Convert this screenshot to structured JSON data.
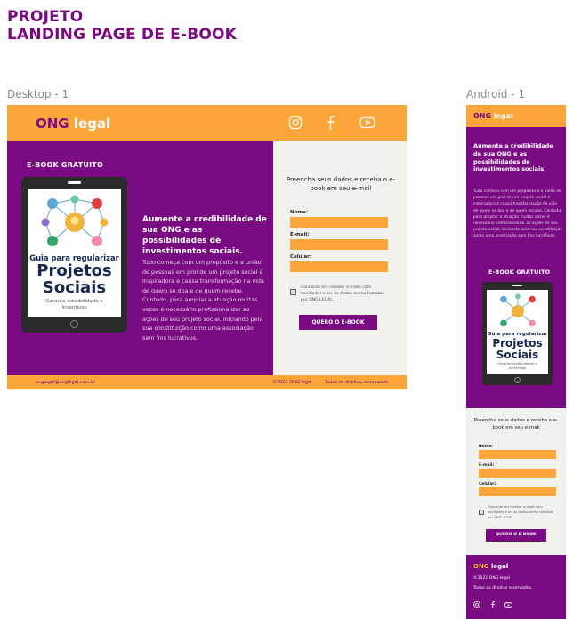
{
  "page": {
    "title_line1": "PROJETO",
    "title_line2": "LANDING PAGE DE E-BOOK"
  },
  "frames": {
    "desktop_label": "Desktop - 1",
    "android_label": "Android - 1"
  },
  "brand": {
    "logo_ong": "ONG",
    "logo_legal": "legal",
    "colors": {
      "purple": "#7a0a82",
      "orange": "#fba63a",
      "form_bg": "#f2f2ec"
    }
  },
  "social_icons": [
    "instagram-icon",
    "facebook-icon",
    "youtube-icon"
  ],
  "hero": {
    "ebook_label": "E-BOOK GRATUITO",
    "heading": "Aumente a credibilidade de sua ONG e as possibilidades de investimentos sociais.",
    "body": "Tudo começa com um propósito e a união de pessoas em prol de um projeto social é inspiradora e causa transformação na vida de quem se doa e de quem recebe. Contudo, para ampliar a atuação muitas vezes é necessário profissionalizar as ações de seu projeto social, iniciando pela sua constituição como uma associação sem fins lucrativos."
  },
  "cover": {
    "line1": "Guia para regularizar",
    "line2": "Projetos",
    "line3": "Sociais",
    "subtitle": "Garanta credibilidade e incentivos"
  },
  "form": {
    "title": "Preencha seus dados e receba o e-book em seu e-mail",
    "name_label": "Nome:",
    "email_label": "E-mail:",
    "phone_label": "Celular:",
    "consent": "Concordo em receber e-mails com novidades e ter os dados acima tratados por ONG LEGAL",
    "submit": "QUERO O E-BOOK"
  },
  "footer": {
    "email": "onglegal@onglegal.com.br",
    "copyright": "©2021 ONG legal",
    "rights": "Todos os direitos reservados."
  }
}
